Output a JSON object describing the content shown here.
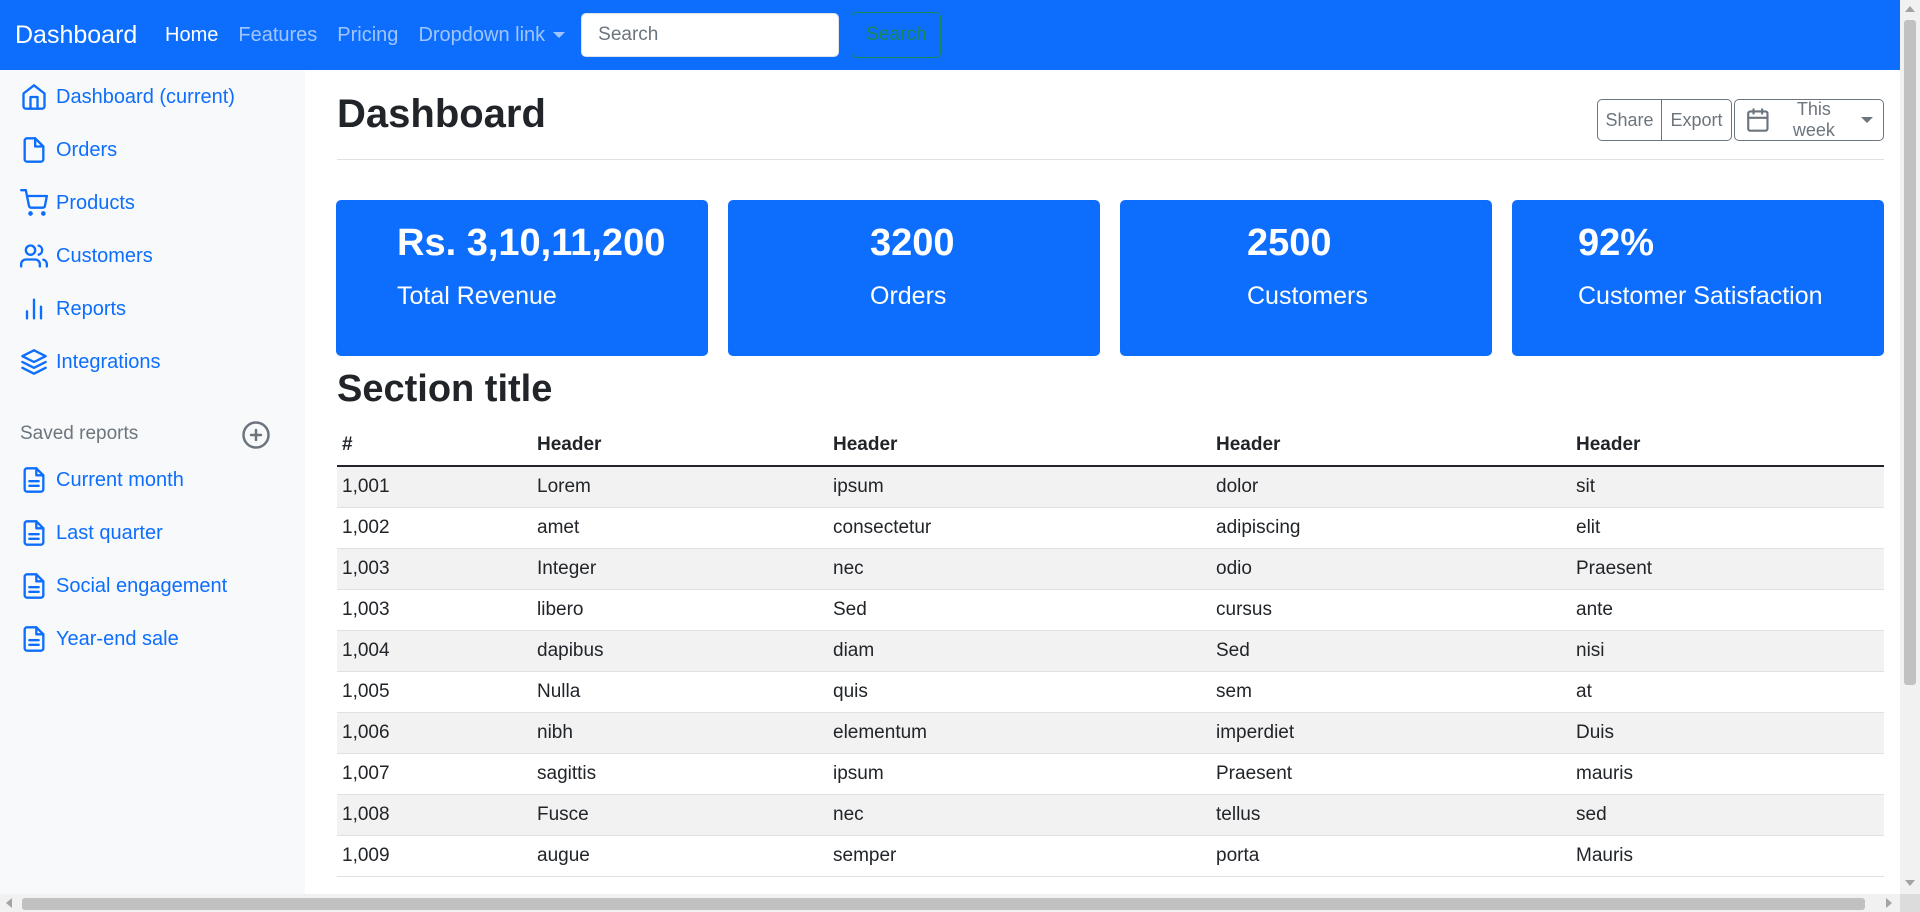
{
  "navbar": {
    "brand": "Dashboard",
    "links": [
      "Home",
      "Features",
      "Pricing",
      "Dropdown link"
    ],
    "search_placeholder": "Search",
    "search_button": "Search"
  },
  "sidebar": {
    "items": [
      {
        "label": "Dashboard (current)",
        "icon": "home-icon"
      },
      {
        "label": "Orders",
        "icon": "file-icon"
      },
      {
        "label": "Products",
        "icon": "cart-icon"
      },
      {
        "label": "Customers",
        "icon": "users-icon"
      },
      {
        "label": "Reports",
        "icon": "bar-chart-icon"
      },
      {
        "label": "Integrations",
        "icon": "layers-icon"
      }
    ],
    "saved_heading": "Saved reports",
    "saved_items": [
      "Current month",
      "Last quarter",
      "Social engagement",
      "Year-end sale"
    ]
  },
  "main": {
    "title": "Dashboard",
    "share": "Share",
    "export": "Export",
    "range": "This week",
    "stats": [
      {
        "value": "Rs. 3,10,11,200",
        "label": "Total Revenue"
      },
      {
        "value": "3200",
        "label": "Orders"
      },
      {
        "value": "2500",
        "label": "Customers"
      },
      {
        "value": "92%",
        "label": "Customer Satisfaction"
      }
    ],
    "section_title": "Section title",
    "table": {
      "headers": [
        "#",
        "Header",
        "Header",
        "Header",
        "Header"
      ],
      "rows": [
        [
          "1,001",
          "Lorem",
          "ipsum",
          "dolor",
          "sit"
        ],
        [
          "1,002",
          "amet",
          "consectetur",
          "adipiscing",
          "elit"
        ],
        [
          "1,003",
          "Integer",
          "nec",
          "odio",
          "Praesent"
        ],
        [
          "1,003",
          "libero",
          "Sed",
          "cursus",
          "ante"
        ],
        [
          "1,004",
          "dapibus",
          "diam",
          "Sed",
          "nisi"
        ],
        [
          "1,005",
          "Nulla",
          "quis",
          "sem",
          "at"
        ],
        [
          "1,006",
          "nibh",
          "elementum",
          "imperdiet",
          "Duis"
        ],
        [
          "1,007",
          "sagittis",
          "ipsum",
          "Praesent",
          "mauris"
        ],
        [
          "1,008",
          "Fusce",
          "nec",
          "tellus",
          "sed"
        ],
        [
          "1,009",
          "augue",
          "semper",
          "porta",
          "Mauris"
        ]
      ]
    }
  },
  "colors": {
    "primary": "#0d6efd",
    "success": "#198754",
    "sidebar_bg": "#f8f9fa"
  }
}
